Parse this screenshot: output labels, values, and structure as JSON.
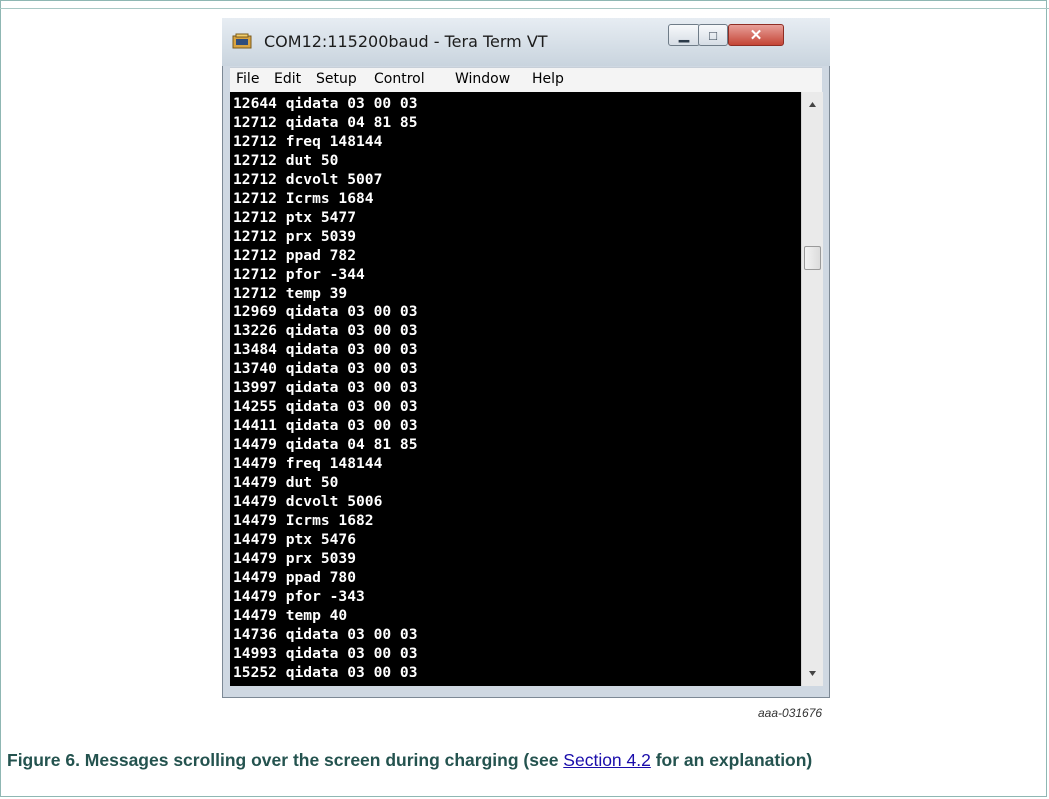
{
  "window": {
    "title": "COM12:115200baud - Tera Term VT",
    "icon": "tera-term-icon",
    "controls": {
      "minimize": "minimize-icon",
      "maximize": "maximize-icon",
      "close": "close-icon"
    }
  },
  "menu": [
    "File",
    "Edit",
    "Setup",
    "Control",
    "Window",
    "Help"
  ],
  "terminal": {
    "lines": [
      "12644 qidata 03 00 03",
      "12712 qidata 04 81 85",
      "12712 freq 148144",
      "12712 dut 50",
      "12712 dcvolt 5007",
      "12712 Icrms 1684",
      "12712 ptx 5477",
      "12712 prx 5039",
      "12712 ppad 782",
      "12712 pfor -344",
      "12712 temp 39",
      "12969 qidata 03 00 03",
      "13226 qidata 03 00 03",
      "13484 qidata 03 00 03",
      "13740 qidata 03 00 03",
      "13997 qidata 03 00 03",
      "14255 qidata 03 00 03",
      "14411 qidata 03 00 03",
      "14479 qidata 04 81 85",
      "14479 freq 148144",
      "14479 dut 50",
      "14479 dcvolt 5006",
      "14479 Icrms 1682",
      "14479 ptx 5476",
      "14479 prx 5039",
      "14479 ppad 780",
      "14479 pfor -343",
      "14479 temp 40",
      "14736 qidata 03 00 03",
      "14993 qidata 03 00 03",
      "15252 qidata 03 00 03"
    ],
    "scroll_position": 0.25
  },
  "figure": {
    "id": "aaa-031676",
    "caption_prefix": "Figure 6.  Messages scrolling over the screen during charging (see ",
    "caption_link": "Section 4.2",
    "caption_suffix": " for an explanation)"
  },
  "colors": {
    "caption": "#24534f",
    "terminal_bg": "#000000",
    "terminal_fg": "#ffffff",
    "link": "#1a0dab"
  }
}
